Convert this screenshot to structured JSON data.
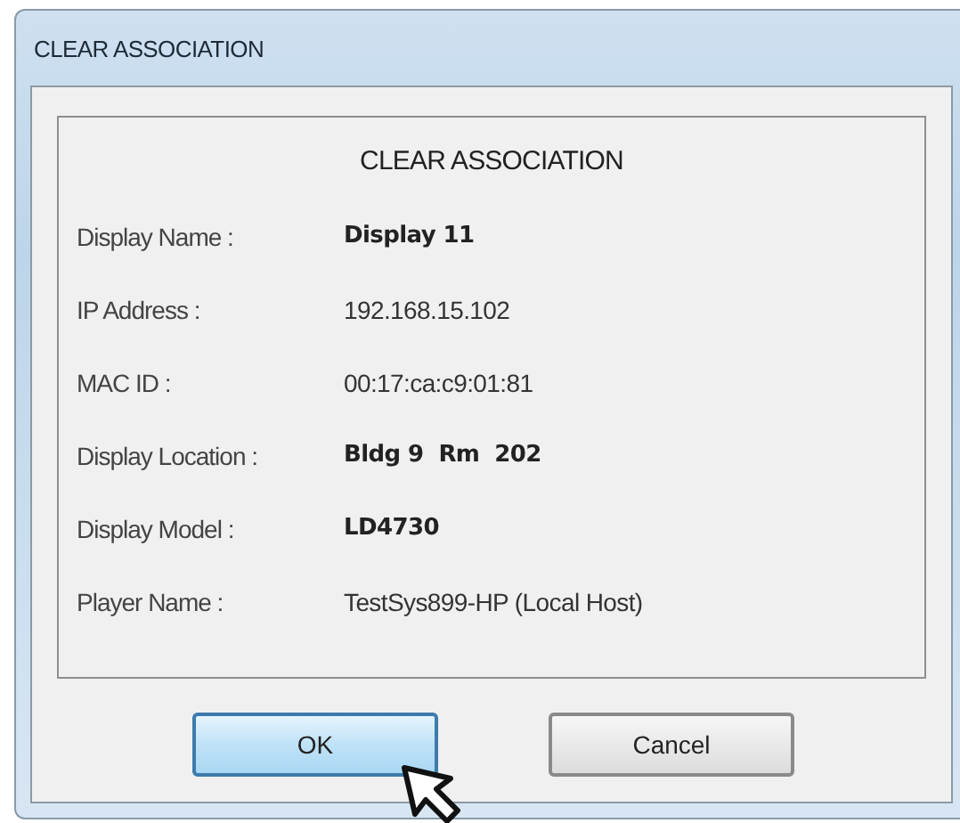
{
  "window": {
    "title": "CLEAR ASSOCIATION"
  },
  "dialog": {
    "heading": "CLEAR ASSOCIATION",
    "fields": [
      {
        "label": "Display Name :",
        "value": "Display 11",
        "bold": true
      },
      {
        "label": "IP Address :",
        "value": "192.168.15.102",
        "bold": false
      },
      {
        "label": "MAC ID :",
        "value": "00:17:ca:c9:01:81",
        "bold": false
      },
      {
        "label": "Display Location :",
        "value": "Bldg 9  Rm  202",
        "bold": true
      },
      {
        "label": "Display Model :",
        "value": "LD4730",
        "bold": true
      },
      {
        "label": "Player Name :",
        "value": "TestSys899-HP (Local Host)",
        "bold": false
      }
    ]
  },
  "buttons": [
    {
      "label": "OK",
      "focused": true
    },
    {
      "label": "Cancel",
      "focused": false
    }
  ]
}
